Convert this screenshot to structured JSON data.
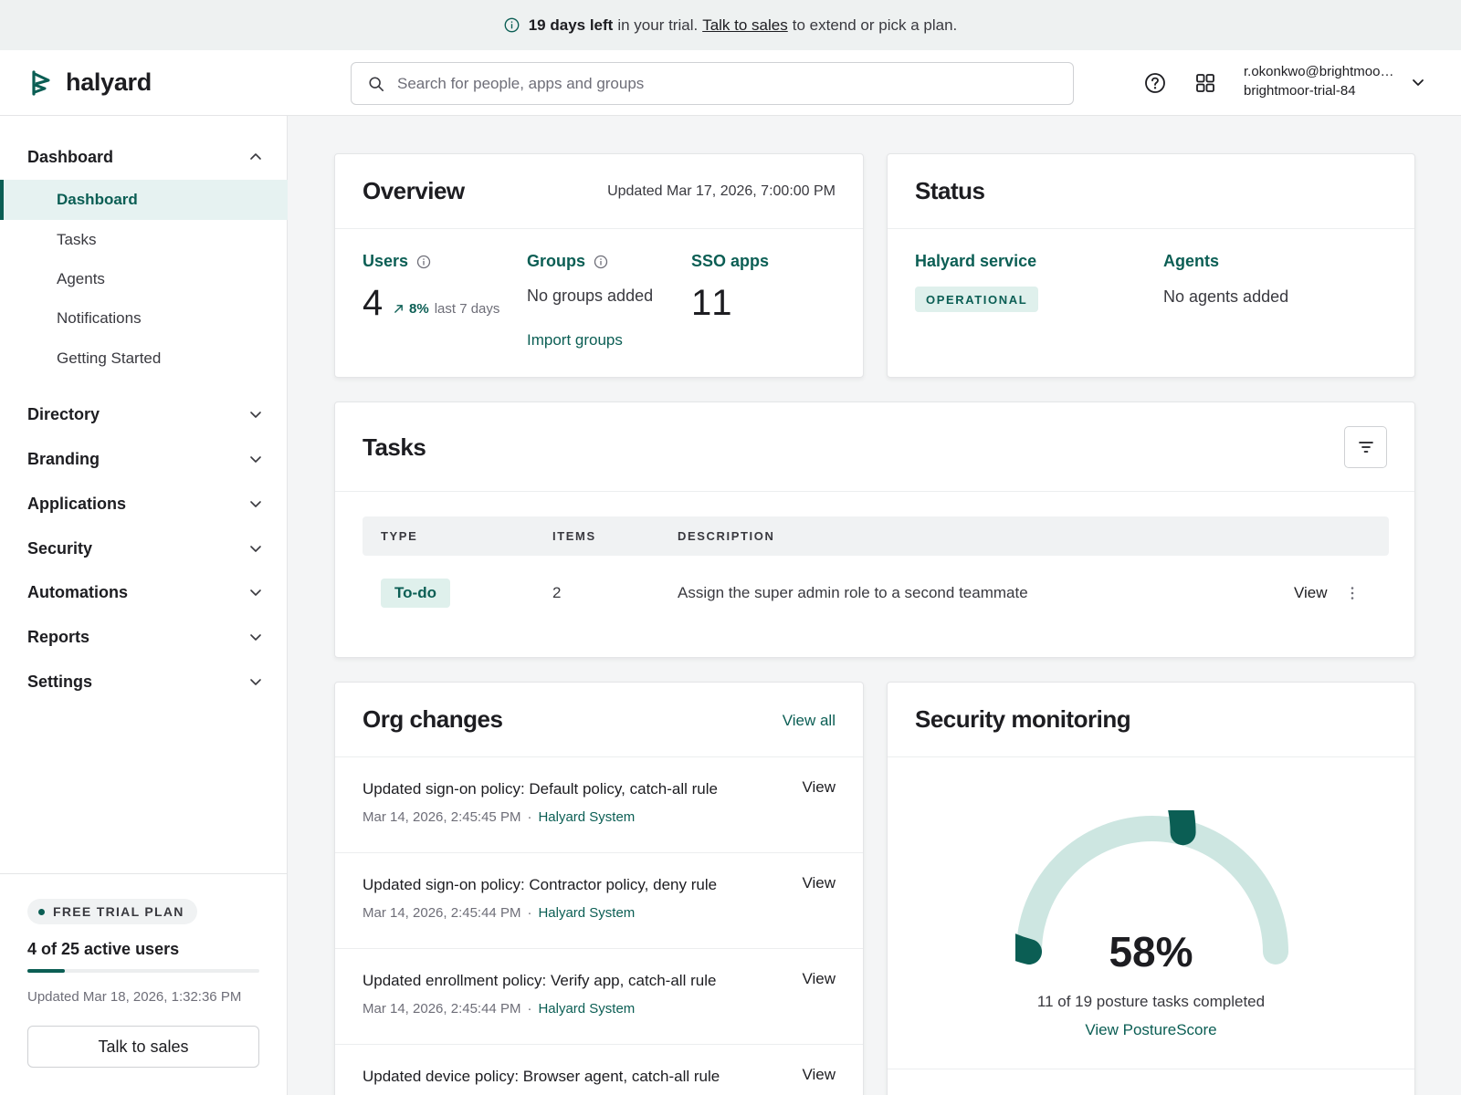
{
  "banner": {
    "days_left": "19 days left",
    "in_trial": "in your trial.",
    "talk_link": "Talk to sales",
    "rest": "to extend or pick a plan."
  },
  "header": {
    "brand": "halyard",
    "search_placeholder": "Search for people, apps and groups",
    "user_email": "r.okonkwo@brightmoo…",
    "org_name": "brightmoor-trial-84"
  },
  "sidebar": {
    "dashboard_group": "Dashboard",
    "dashboard_items": [
      "Dashboard",
      "Tasks",
      "Agents",
      "Notifications",
      "Getting Started"
    ],
    "groups": [
      "Directory",
      "Branding",
      "Applications",
      "Security",
      "Automations",
      "Reports",
      "Settings"
    ],
    "trial": {
      "plan_label": "FREE TRIAL PLAN",
      "active_users": "4 of 25 active users",
      "active_fraction": 0.16,
      "updated": "Updated Mar 18, 2026, 1:32:36 PM",
      "button": "Talk to sales"
    }
  },
  "overview": {
    "title": "Overview",
    "updated": "Updated Mar 17, 2026, 7:00:00 PM",
    "users_label": "Users",
    "users_count": "4",
    "users_trend_pct": "8%",
    "users_trend_label": "last 7 days",
    "groups_label": "Groups",
    "groups_empty": "No groups added",
    "groups_import": "Import groups",
    "sso_label": "SSO apps",
    "sso_count": "11"
  },
  "status": {
    "title": "Status",
    "service_label": "Halyard service",
    "service_state": "OPERATIONAL",
    "agents_label": "Agents",
    "agents_empty": "No agents added"
  },
  "tasks": {
    "title": "Tasks",
    "columns": [
      "TYPE",
      "ITEMS",
      "DESCRIPTION"
    ],
    "rows": [
      {
        "type": "To-do",
        "items": "2",
        "description": "Assign the super admin role to a second teammate",
        "action": "View"
      }
    ]
  },
  "org_changes": {
    "title": "Org changes",
    "view_all": "View all",
    "items": [
      {
        "title": "Updated sign-on policy: Default policy, catch-all rule",
        "time": "Mar 14, 2026, 2:45:45 PM",
        "actor": "Halyard System",
        "action": "View"
      },
      {
        "title": "Updated sign-on policy: Contractor policy, deny rule",
        "time": "Mar 14, 2026, 2:45:44 PM",
        "actor": "Halyard System",
        "action": "View"
      },
      {
        "title": "Updated enrollment policy: Verify app, catch-all rule",
        "time": "Mar 14, 2026, 2:45:44 PM",
        "actor": "Halyard System",
        "action": "View"
      },
      {
        "title": "Updated device policy: Browser agent, catch-all rule",
        "time": "",
        "actor": "",
        "action": "View"
      }
    ]
  },
  "security": {
    "title": "Security monitoring",
    "score_pct": 58,
    "score_label": "58%",
    "completed": "11 of 19 posture tasks completed",
    "link": "View PostureScore"
  },
  "colors": {
    "accent": "#0b5e54",
    "accent_light": "#cde6e1",
    "badge_bg": "#dff0ec"
  }
}
